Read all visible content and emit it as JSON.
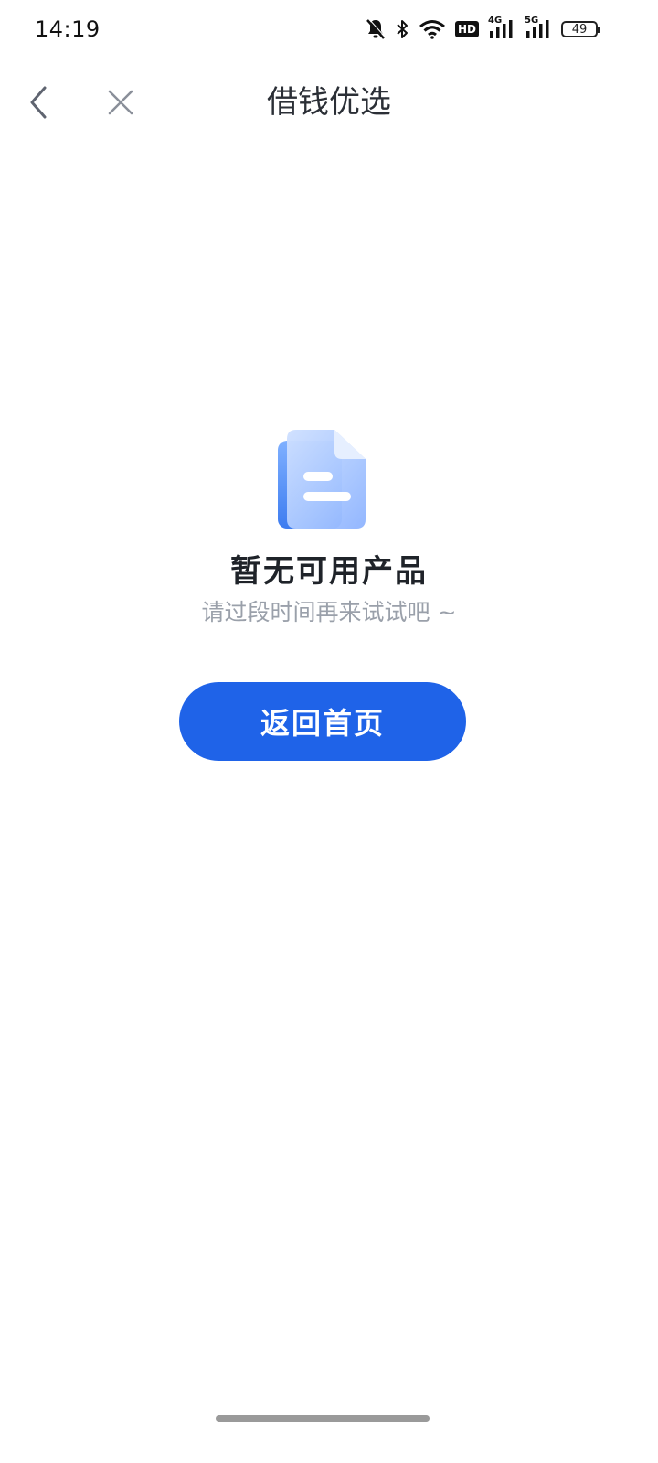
{
  "status_bar": {
    "time": "14:19",
    "icons": [
      "bell-off-icon",
      "bluetooth-icon",
      "wifi-icon",
      "hd-icon",
      "signal-4g-icon",
      "signal-5g-icon",
      "battery-icon"
    ],
    "hd_label": "HD",
    "net_4g_label": "4G",
    "net_5g_label": "5G",
    "battery_level": "49"
  },
  "nav": {
    "title": "借钱优选",
    "back_icon": "chevron-left-icon",
    "close_icon": "close-icon"
  },
  "empty_state": {
    "icon": "document-icon",
    "title": "暂无可用产品",
    "subtitle": "请过段时间再来试试吧 ~",
    "button_label": "返回首页"
  },
  "colors": {
    "primary": "#1f63e8",
    "title_text": "#1f2329",
    "subtitle_text": "#9aa0aa",
    "icon_gray": "#8a8f99"
  }
}
